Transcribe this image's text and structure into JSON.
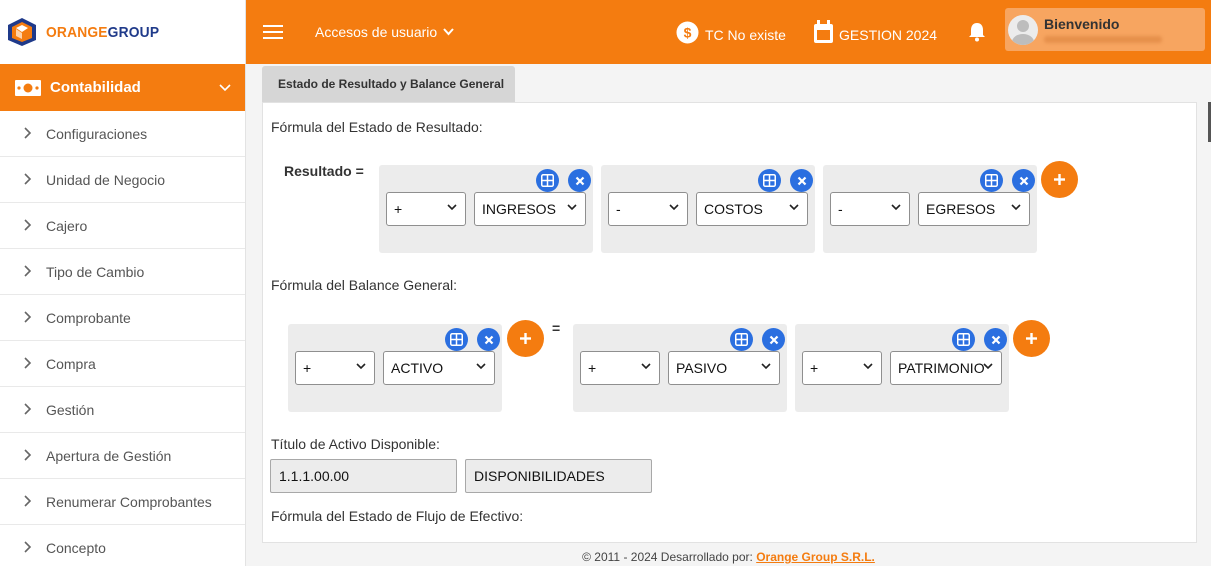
{
  "brand": {
    "name_orange": "ORANGE",
    "name_group": "GROUP"
  },
  "sidebar": {
    "section": "Contabilidad",
    "items": [
      {
        "label": "Configuraciones"
      },
      {
        "label": "Unidad de Negocio"
      },
      {
        "label": "Cajero"
      },
      {
        "label": "Tipo de Cambio"
      },
      {
        "label": "Comprobante"
      },
      {
        "label": "Compra"
      },
      {
        "label": "Gestión"
      },
      {
        "label": "Apertura de Gestión"
      },
      {
        "label": "Renumerar Comprobantes"
      },
      {
        "label": "Concepto"
      }
    ]
  },
  "topbar": {
    "accesos": "Accesos de usuario",
    "tc": "TC No existe",
    "gestion": "GESTION 2024",
    "user_greeting": "Bienvenido"
  },
  "tabs": [
    {
      "label": "Estado de Resultado y Balance General"
    }
  ],
  "resultado": {
    "title": "Fórmula del Estado de Resultado:",
    "lhs": "Resultado =",
    "terms": [
      {
        "op": "+",
        "account": "INGRESOS"
      },
      {
        "op": "-",
        "account": "COSTOS"
      },
      {
        "op": "-",
        "account": "EGRESOS"
      }
    ]
  },
  "balance": {
    "title": "Fórmula del Balance General:",
    "equals": "=",
    "left_terms": [
      {
        "op": "+",
        "account": "ACTIVO"
      }
    ],
    "right_terms": [
      {
        "op": "+",
        "account": "PASIVO"
      },
      {
        "op": "+",
        "account": "PATRIMONIO"
      }
    ]
  },
  "activo_disponible": {
    "title": "Título de Activo Disponible:",
    "code": "1.1.1.00.00",
    "name": "DISPONIBILIDADES"
  },
  "flujo": {
    "title": "Fórmula del Estado de Flujo de Efectivo:"
  },
  "footer": {
    "text": "© 2011 - 2024 Desarrollado por:",
    "link": "Orange Group S.R.L."
  },
  "colors": {
    "accent": "#f47c10",
    "icon_blue": "#2b6fe0"
  }
}
